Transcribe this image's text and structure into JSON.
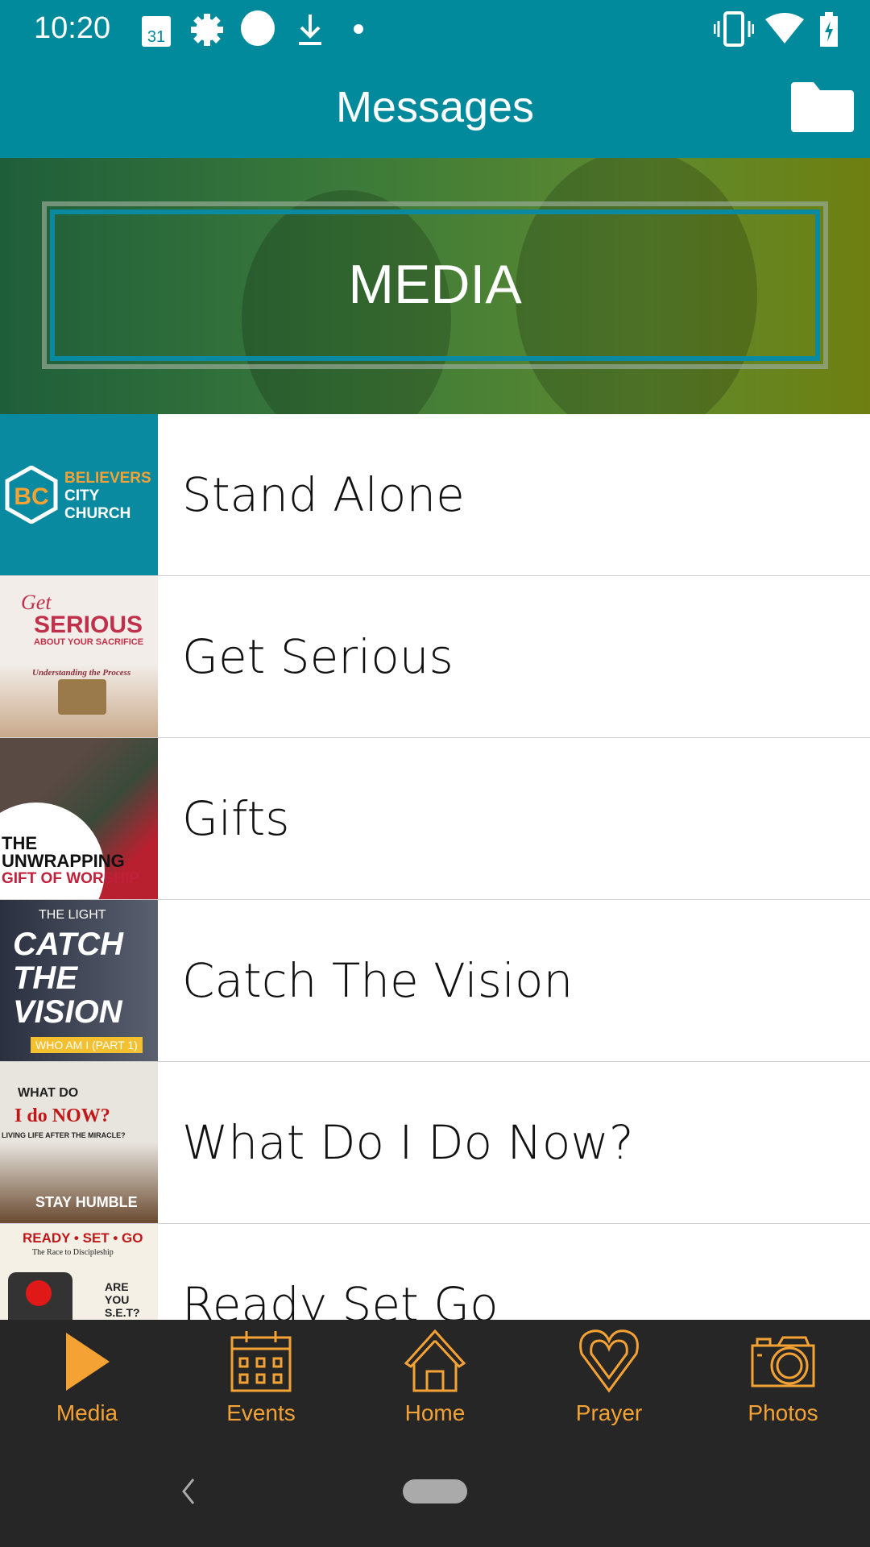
{
  "status_bar": {
    "time": "10:20",
    "calendar_day": "31",
    "icons": [
      "calendar-icon",
      "settings-icon",
      "circle-icon",
      "download-icon",
      "dot-icon",
      "vibrate-icon",
      "wifi-icon",
      "battery-charging-icon"
    ]
  },
  "app_bar": {
    "title": "Messages",
    "action_icon": "folder-icon"
  },
  "banner": {
    "label": "MEDIA"
  },
  "messages": [
    {
      "title": "Stand Alone",
      "thumb_text": [
        "BELIEVERS",
        "CITY",
        "CHURCH"
      ],
      "thumb_color": "#0a8aa0"
    },
    {
      "title": "Get Serious",
      "thumb_text": [
        "Get",
        "SERIOUS",
        "ABOUT YOUR SACRIFICE",
        "Understanding the Process"
      ],
      "thumb_color": "#e8e2dc"
    },
    {
      "title": "Gifts",
      "thumb_text": [
        "THE",
        "UNWRAPPING",
        "GIFT OF WORSHIP"
      ],
      "thumb_color": "#5a4a44"
    },
    {
      "title": "Catch The Vision",
      "thumb_text": [
        "THE LIGHT",
        "CATCH",
        "THE",
        "VISION",
        "WHO AM I (PART 1)"
      ],
      "thumb_color": "#3a4050"
    },
    {
      "title": "What Do I Do Now?",
      "thumb_text": [
        "WHAT DO",
        "I do NOW?",
        "LIVING LIFE AFTER THE MIRACLE?",
        "STAY HUMBLE"
      ],
      "thumb_color": "#8a6a50"
    },
    {
      "title": "Ready Set Go",
      "thumb_text": [
        "READY • SET • GO",
        "The Race to Discipleship",
        "ARE YOU S.E.T?"
      ],
      "thumb_color": "#f4f0e6"
    }
  ],
  "bottom_nav": [
    {
      "label": "Media",
      "icon": "play-icon",
      "active": true
    },
    {
      "label": "Events",
      "icon": "calendar-icon"
    },
    {
      "label": "Home",
      "icon": "home-icon"
    },
    {
      "label": "Prayer",
      "icon": "heart-icon"
    },
    {
      "label": "Photos",
      "icon": "camera-icon"
    }
  ],
  "colors": {
    "primary": "#008a9c",
    "accent": "#f5a234",
    "nav_bg": "#262626"
  }
}
